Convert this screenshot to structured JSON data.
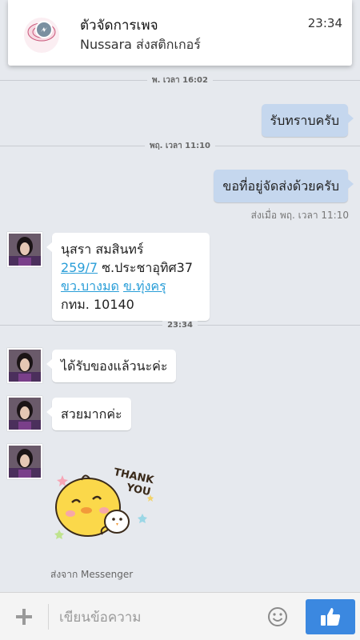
{
  "notification": {
    "title": "ตัวจัดการเพจ",
    "time": "23:34",
    "text": "Nussara ส่งสติกเกอร์"
  },
  "separators": [
    {
      "label": "พ. เวลา 16:02"
    },
    {
      "label": "พฤ. เวลา 11:10"
    },
    {
      "label": "23:34"
    }
  ],
  "messages": {
    "out1": "รับทราบครับ",
    "out2": "ขอที่อยู่จัดส่งด้วยครับ",
    "out2_status": "ส่งเมื่อ พฤ. เวลา 11:10",
    "address": {
      "line1": "นุสรา สมสินทร์",
      "line2_link": "259/7",
      "line2_rest": " ซ.ประชาอุทิศ37",
      "line3_link1": "ขว.บางมด",
      "line3_link2": "ข.ทุ่งครุ",
      "line4": "กทม. 10140"
    },
    "in2": "ได้รับของแล้วนะค่ะ",
    "in3": "สวยมากค่ะ",
    "sticker_text": "THANK YOU",
    "sent_from": "ส่งจาก Messenger"
  },
  "composer": {
    "placeholder": "เขียนข้อความ"
  },
  "colors": {
    "background": "#e6e9ee",
    "outgoing_bubble": "#c5d7ee",
    "incoming_bubble": "#ffffff",
    "link": "#2a9ed8",
    "like_button": "#3b88e0"
  },
  "icons": {
    "add": "plus-icon",
    "emoji": "smiley-icon",
    "like": "thumbs-up-icon",
    "messenger_badge": "messenger-icon"
  }
}
